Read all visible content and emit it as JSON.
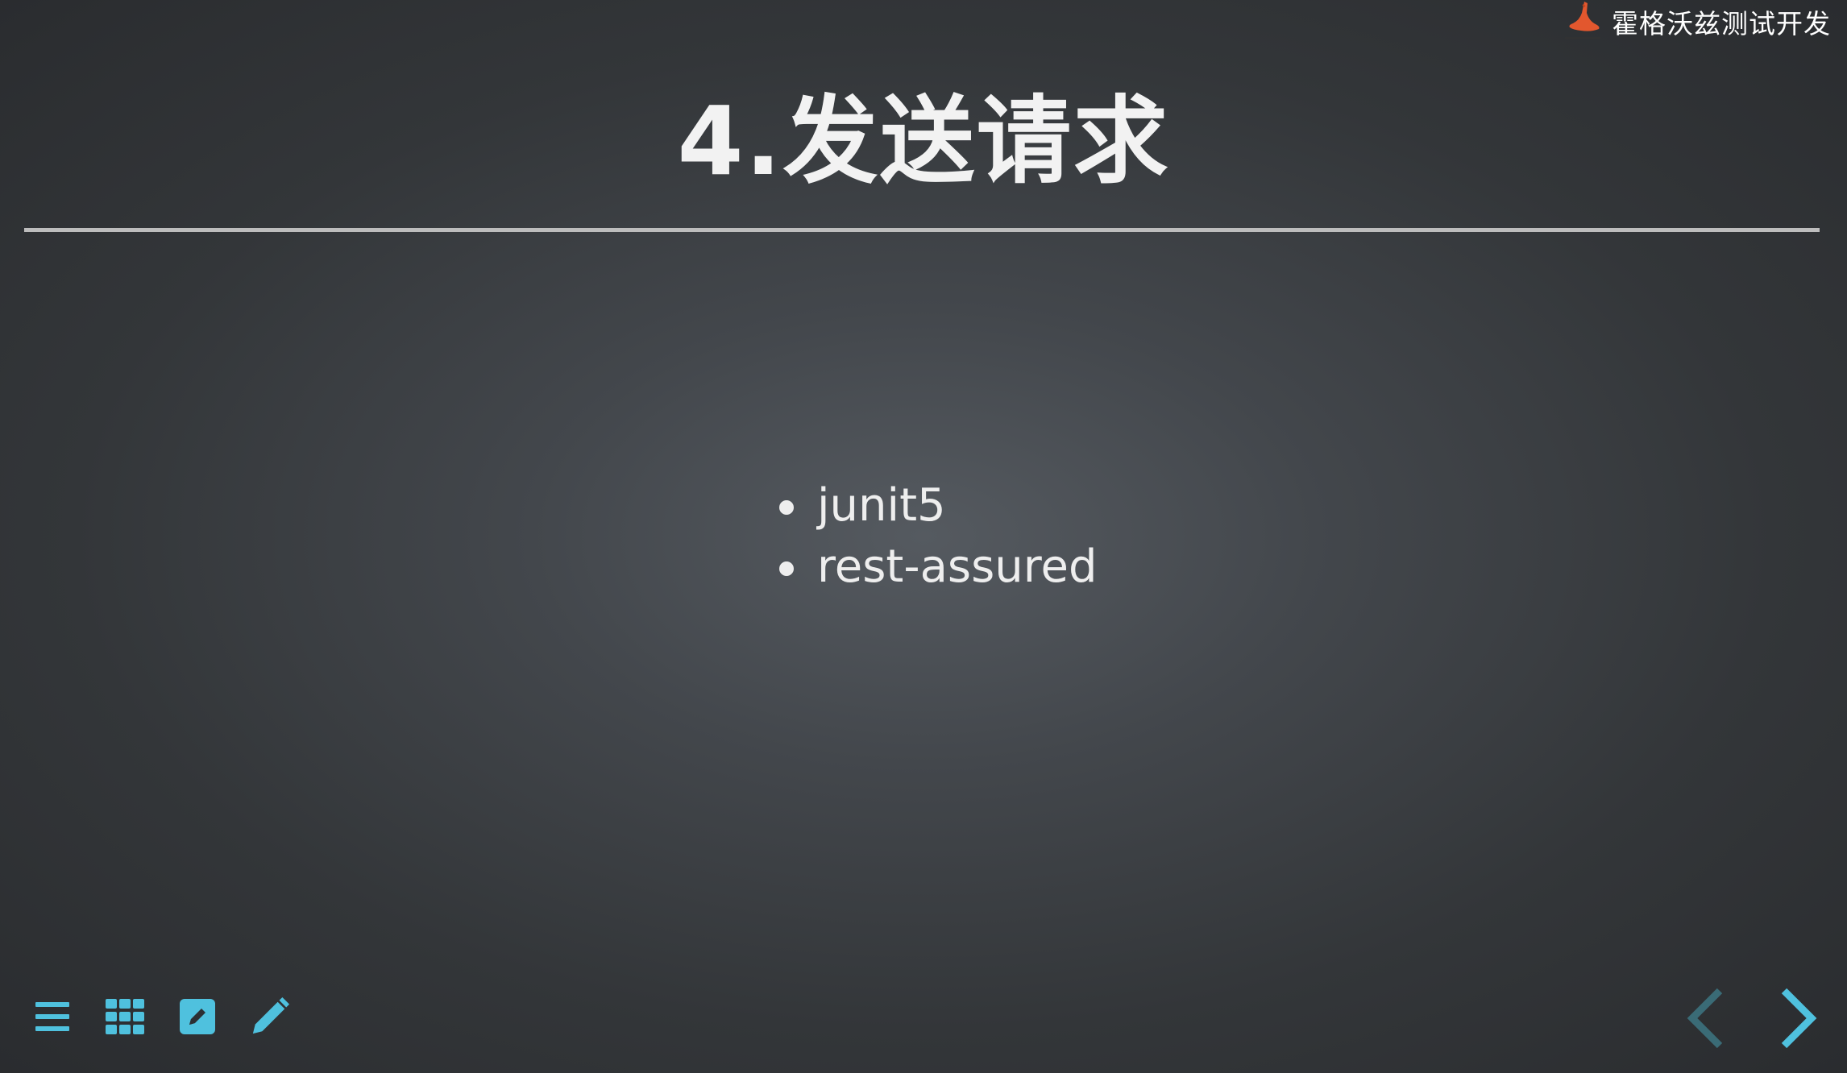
{
  "brand": {
    "name": "霍格沃兹测试开发"
  },
  "slide": {
    "title": "4.发送请求",
    "bullets": [
      "junit5",
      "rest-assured"
    ]
  },
  "toolbar": {
    "items": [
      {
        "icon": "menu-icon"
      },
      {
        "icon": "grid-icon"
      },
      {
        "icon": "edit-icon"
      },
      {
        "icon": "pencil-icon"
      }
    ]
  },
  "navigation": {
    "prev_icon": "chevron-left-icon",
    "next_icon": "chevron-right-icon"
  },
  "colors": {
    "accent": "#4fc1de",
    "accent_dim": "#3a6b76",
    "logo": "#e2572e",
    "text": "#eeeeee"
  }
}
